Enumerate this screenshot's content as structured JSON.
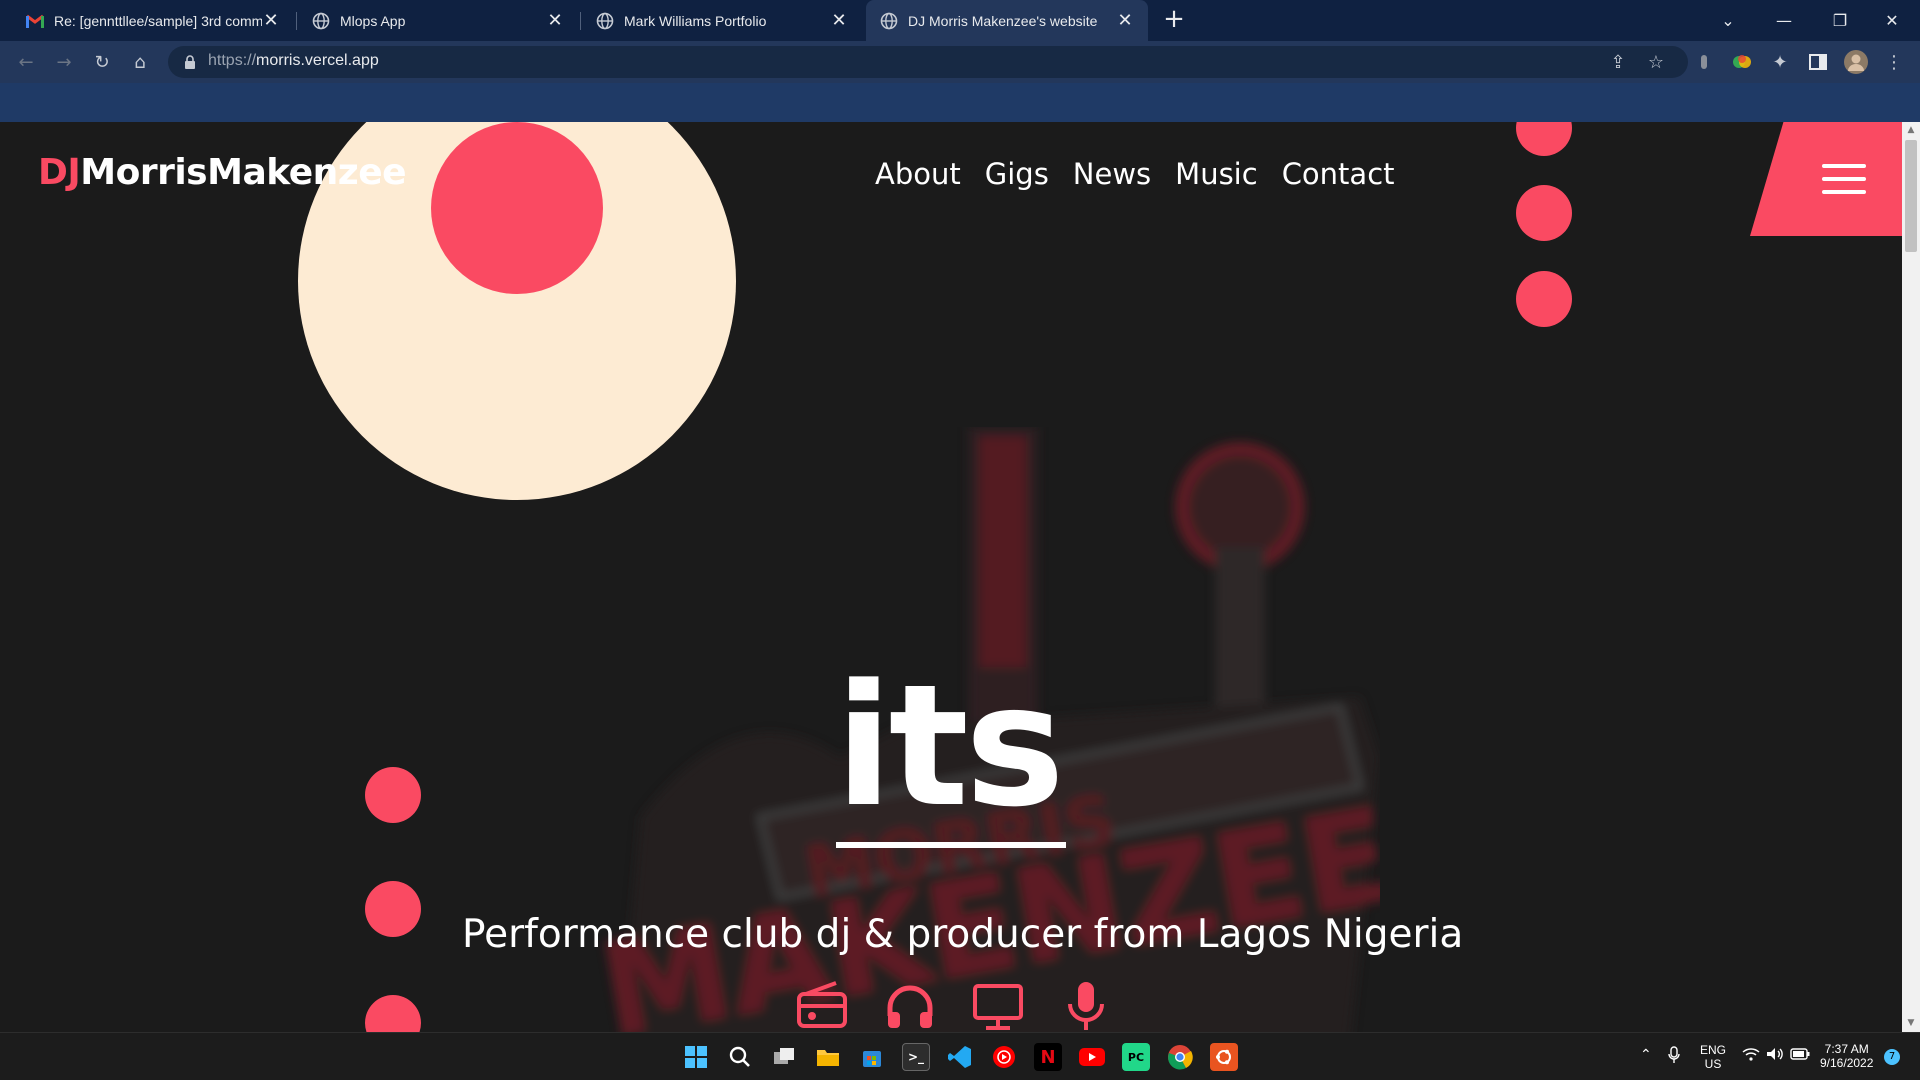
{
  "browser": {
    "tabs": [
      {
        "title": "Re: [gennttllee/sample] 3rd comm",
        "icon": "gmail-icon"
      },
      {
        "title": "Mlops App",
        "icon": "globe-icon"
      },
      {
        "title": "Mark Williams Portfolio",
        "icon": "globe-icon"
      },
      {
        "title": "DJ Morris Makenzee's website",
        "icon": "globe-icon"
      }
    ],
    "url_scheme": "https://",
    "url_host": "morris.vercel.app"
  },
  "site": {
    "logo_prefix": "DJ",
    "logo_name": "MorrisMakenzee",
    "nav": [
      "About",
      "Gigs",
      "News",
      "Music",
      "Contact"
    ],
    "hero_word": "its",
    "tagline": "Performance club dj & producer from Lagos Nigeria",
    "hero_icons": [
      "radio-icon",
      "headphones-icon",
      "monitor-icon",
      "microphone-icon"
    ]
  },
  "taskbar": {
    "lang_top": "ENG",
    "lang_bottom": "US",
    "time": "7:37 AM",
    "date": "9/16/2022",
    "notification_count": "7"
  },
  "colors": {
    "accent": "#fa4a62",
    "cream": "#fdebd3",
    "background": "#1b1b1b",
    "tabbar": "#0f2141",
    "toolbar": "#23375b"
  }
}
